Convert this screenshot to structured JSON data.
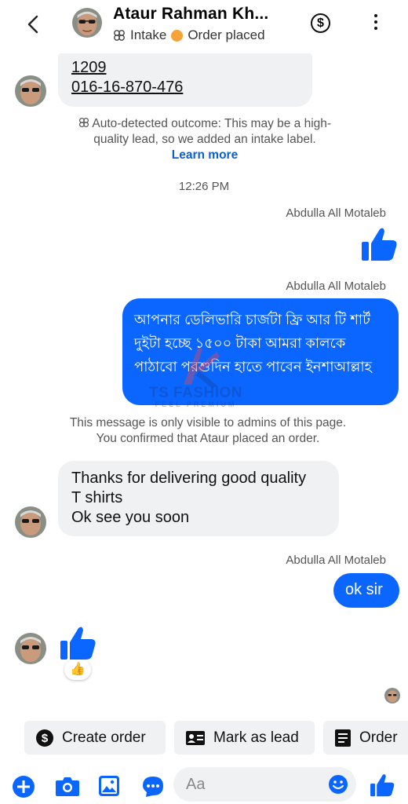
{
  "header": {
    "name": "Ataur Rahman Kh...",
    "label_intake": "Intake",
    "label_order": "Order placed",
    "dollar_symbol": "$"
  },
  "messages": {
    "incoming_contact_line1": "1209",
    "incoming_contact_line2": "016-16-870-476",
    "auto_detect_text": "Auto-detected outcome: This may be a high-quality lead, so we added an intake label.",
    "auto_detect_link": "Learn more",
    "time": "12:26 PM",
    "sender_1": "Abdulla All Motaleb",
    "sender_2": "Abdulla All Motaleb",
    "bangla_message": "আপনার ডেলিভারি চার্জটা ফ্রি আর টি শার্ট দুইটা হচ্ছে ১৫০০ টাকা আমরা কালকে পাঠাবো পরশুদিন হাতে পাবেন ইনশাআল্লাহ",
    "visibility_note": "This message is only visible to admins of this page. You confirmed that Ataur placed an order.",
    "thanks_line1": "Thanks for delivering good  quality",
    "thanks_line2": "T shirts",
    "thanks_line3": "Ok see you soon",
    "sender_3": "Abdulla All Motaleb",
    "ok_sir": "ok sir",
    "reaction_emoji": "👍"
  },
  "watermark": {
    "brand": "TS FASHION",
    "tagline": "FEEL PREMIUM"
  },
  "quick_actions": {
    "create_order": "Create order",
    "mark_as_lead": "Mark as lead",
    "order": "Order"
  },
  "composer": {
    "placeholder": "Aa"
  },
  "colors": {
    "accent_blue": "#0a66ff",
    "bubble_gray": "#f0f1f3",
    "intake_dot": "#f6a33a"
  }
}
